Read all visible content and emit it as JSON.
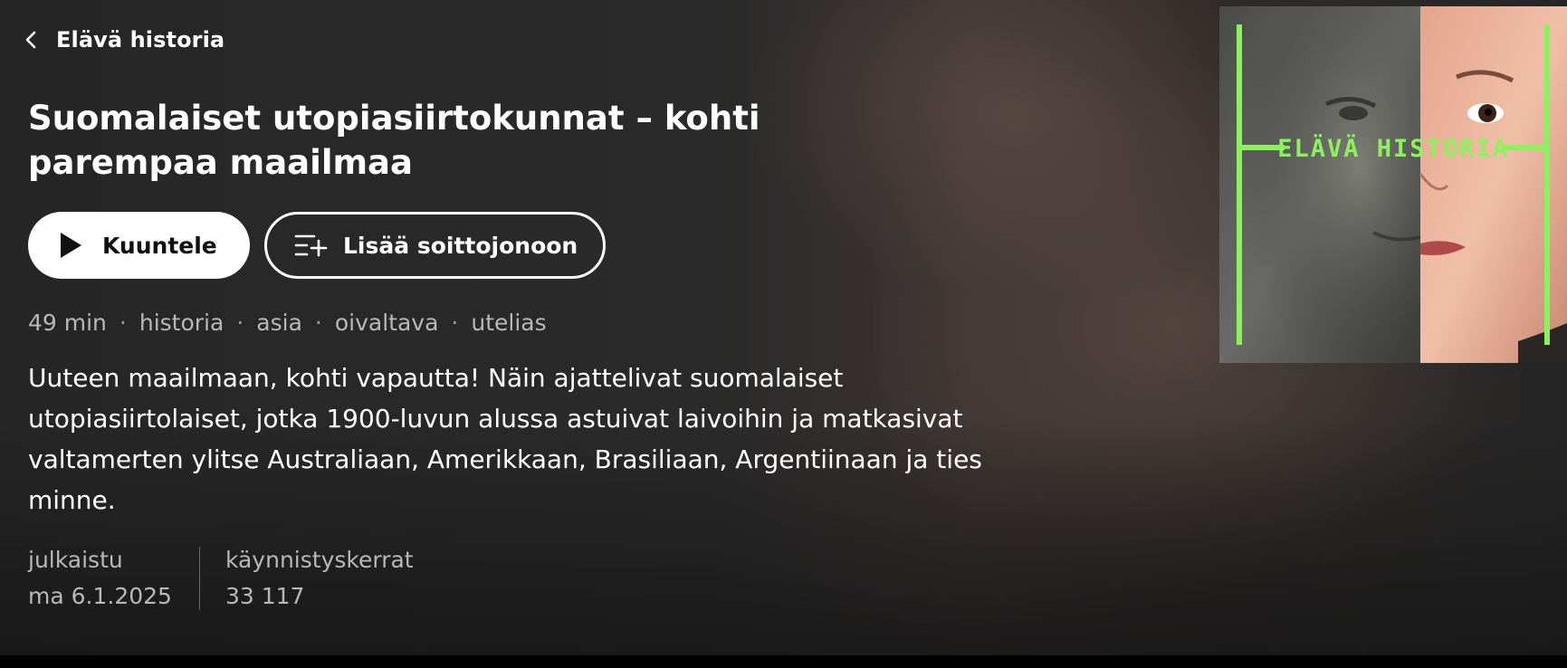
{
  "nav": {
    "back_label": "Elävä historia"
  },
  "episode": {
    "title": "Suomalaiset utopiasiirtokunnat – kohti parempaa maailmaa",
    "description": "Uuteen maailmaan, kohti vapautta! Näin ajattelivat suomalaiset utopiasiirtolaiset, jotka 1900-luvun alussa astuivat laivoihin ja matkasivat valtamerten ylitse Australiaan, Amerikkaan, Brasiliaan, Argentiinaan ja ties minne."
  },
  "actions": {
    "play_label": "Kuuntele",
    "queue_label": "Lisää soittojonoon"
  },
  "meta": {
    "duration": "49 min",
    "tags": [
      "historia",
      "asia",
      "oivaltava",
      "utelias"
    ],
    "separator": "·"
  },
  "stats": {
    "published_label": "julkaistu",
    "published_value": "ma 6.1.2025",
    "plays_label": "käynnistyskerrat",
    "plays_value": "33 117"
  },
  "cover": {
    "series_text": "ELÄVÄ HISTORIA",
    "accent_color": "#8af25a"
  },
  "icons": {
    "back": "chevron-left-icon",
    "play": "play-icon",
    "queue": "queue-add-icon"
  }
}
